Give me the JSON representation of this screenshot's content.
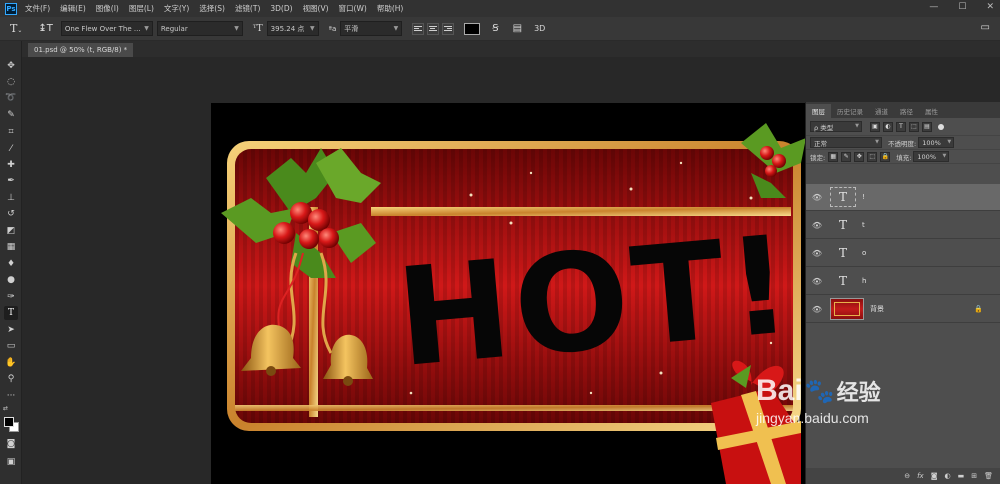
{
  "app": {
    "logo_text": "Ps",
    "menu": [
      "文件(F)",
      "编辑(E)",
      "图像(I)",
      "图层(L)",
      "文字(Y)",
      "选择(S)",
      "滤镜(T)",
      "3D(D)",
      "视图(V)",
      "窗口(W)",
      "帮助(H)"
    ],
    "window_controls": [
      "—",
      "☐",
      "✕"
    ]
  },
  "options_bar": {
    "font_family": "One Flew Over The ...",
    "font_style": "Regular",
    "font_size": "395.24 点",
    "antialias": "平滑",
    "text_color": "#000000",
    "label_3d": "3D"
  },
  "document": {
    "tab_title": "01.psd @ 50% (t, RGB/8) *"
  },
  "artwork": {
    "headline": "HOT!"
  },
  "layers_panel": {
    "tabs": [
      "图层",
      "历史记录",
      "通道",
      "路径",
      "属性"
    ],
    "filter_label": "ρ 类型",
    "blend_mode": "正常",
    "opacity_label": "不透明度:",
    "opacity_value": "100%",
    "lock_label": "锁定:",
    "fill_label": "填充:",
    "fill_value": "100%",
    "layers": [
      {
        "name": "!",
        "thumb": "T",
        "selected": true
      },
      {
        "name": "t",
        "thumb": "T",
        "selected": false
      },
      {
        "name": "o",
        "thumb": "T",
        "selected": false
      },
      {
        "name": "h",
        "thumb": "T",
        "selected": false
      },
      {
        "name": "背景",
        "thumb": "image",
        "selected": false
      }
    ],
    "footer_icons": [
      "link-icon",
      "fx-icon",
      "mask-icon",
      "adjustment-icon",
      "folder-icon",
      "new-layer-icon",
      "trash-icon"
    ]
  },
  "watermark": {
    "brand": "Bai",
    "brand_suffix": "经验",
    "url": "jingyan.baidu.com"
  }
}
